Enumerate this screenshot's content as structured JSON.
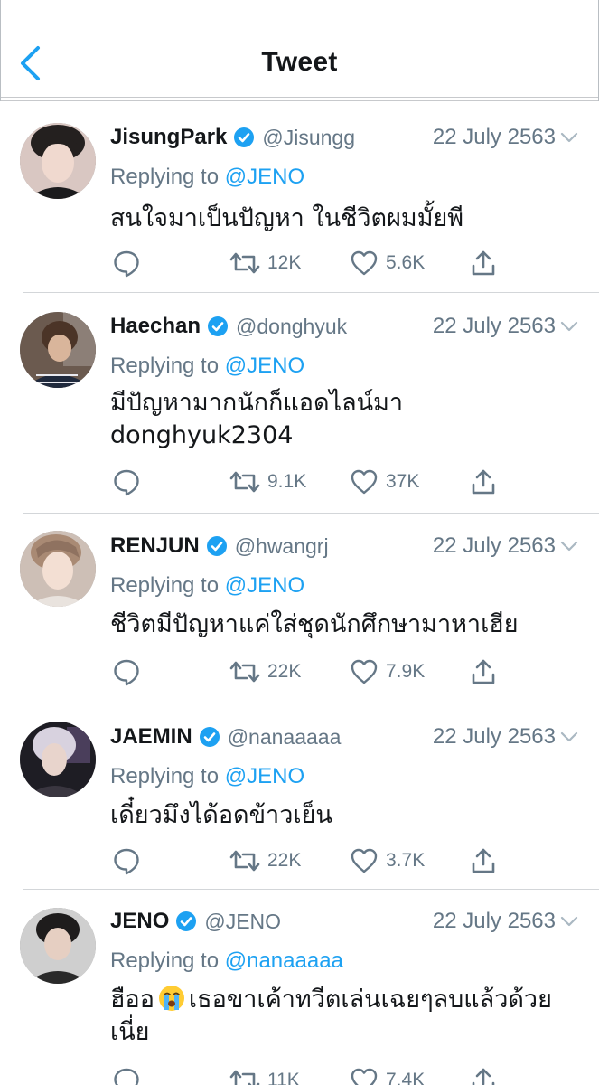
{
  "header": {
    "title": "Tweet"
  },
  "colors": {
    "accent": "#1da1f2",
    "text": "#14171a",
    "secondary": "#657786"
  },
  "reply_prefix": "Replying to",
  "tweets": [
    {
      "name": "JisungPark",
      "handle": "@Jisungg",
      "date": "22 July 2563",
      "reply_to": "@JENO",
      "text": "สนใจมาเป็นปัญหา ในชีวิตผมมั้ยพี",
      "retweets": "12K",
      "likes": "5.6K",
      "avatar_icon": "profile-photo-jisung"
    },
    {
      "name": "Haechan",
      "handle": "@donghyuk",
      "date": "22 July 2563",
      "reply_to": "@JENO",
      "text_line1": "มีปัญหามากนักก็แอดไลน์มา",
      "text_line2": "donghyuk2304",
      "retweets": "9.1K",
      "likes": "37K",
      "avatar_icon": "profile-photo-haechan"
    },
    {
      "name": "RENJUN",
      "handle": "@hwangrj",
      "date": "22 July 2563",
      "reply_to": "@JENO",
      "text": "ชีวิตมีปัญหาแค่ใส่ชุดนักศึกษามาหาเฮีย",
      "retweets": "22K",
      "likes": "7.9K",
      "avatar_icon": "profile-photo-renjun"
    },
    {
      "name": "JAEMIN",
      "handle": "@nanaaaaa",
      "date": "22 July 2563",
      "reply_to": "@JENO",
      "text": "เดี๋ยวมึงได้อดข้าวเย็น",
      "retweets": "22K",
      "likes": "3.7K",
      "avatar_icon": "profile-photo-jaemin"
    },
    {
      "name": "JENO",
      "handle": "@JENO",
      "date": "22 July 2563",
      "reply_to": "@nanaaaaa",
      "text_part1": "ฮืออ",
      "emoji": "loudly-crying-face-icon",
      "text_part2": "เธอขาเค้าทวีตเล่นเฉยๆลบแล้วด้วย",
      "text_line2": "เนี่ย",
      "retweets": "11K",
      "likes": "7.4K",
      "avatar_icon": "profile-photo-jeno"
    }
  ]
}
